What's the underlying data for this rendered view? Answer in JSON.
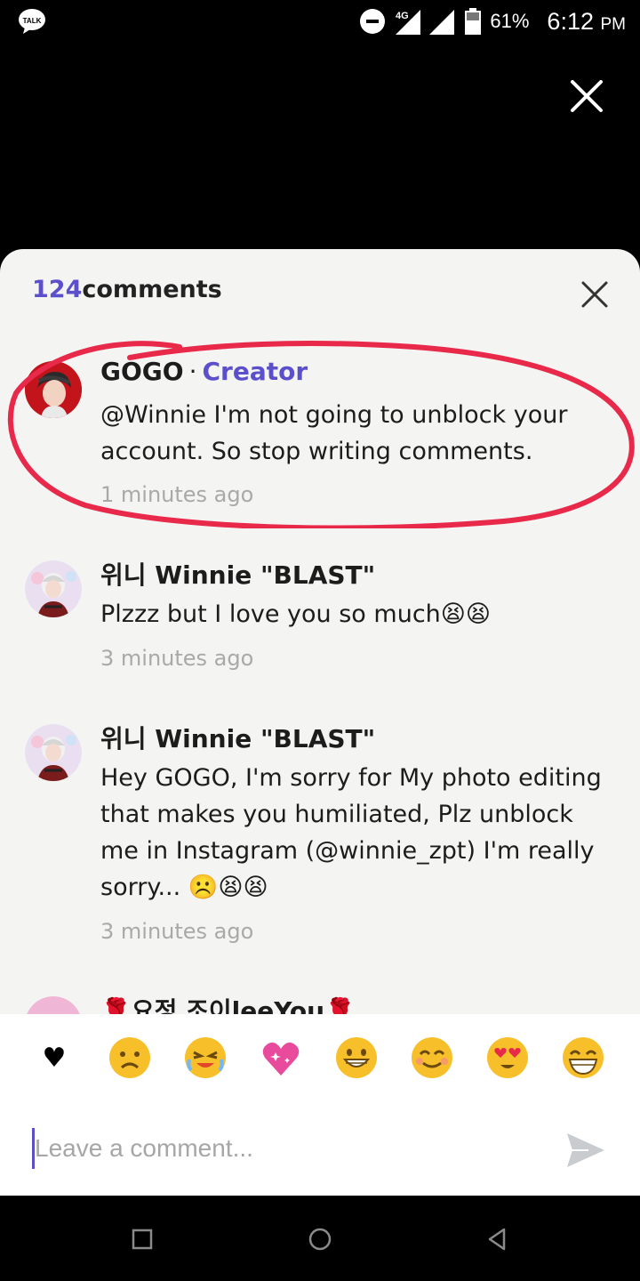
{
  "status_bar": {
    "app_icon_label": "TALK",
    "network": "4G",
    "battery": "61%",
    "time": "6:12",
    "ampm": "PM"
  },
  "sheet": {
    "count": "124",
    "title_suffix": "comments"
  },
  "comments": [
    {
      "name": "GOGO",
      "dot": "·",
      "role": "Creator",
      "text": "@Winnie I'm not going to unblock your account. So stop writing comments.",
      "time": "1 minutes ago"
    },
    {
      "name": "위니 Winnie \"BLAST\"",
      "text": "Plzzz but I love you so much😫😫",
      "time": "3 minutes ago"
    },
    {
      "name": "위니 Winnie \"BLAST\"",
      "text": "Hey GOGO, I'm sorry for My photo editing that makes you humiliated, Plz unblock me in Instagram (@winnie_zpt) I'm really sorry... ☹️😫😫",
      "time": "3 minutes ago"
    },
    {
      "name": "🌹요정 조이leeYou🌹"
    }
  ],
  "emoji_bar": {
    "heart": "♥",
    "emojis": [
      "frown-emoji",
      "crying-emoji",
      "sparkle-heart-emoji",
      "grin-emoji",
      "smile-emoji",
      "heart-eyes-emoji",
      "laughing-emoji"
    ]
  },
  "input": {
    "placeholder": "Leave a comment..."
  },
  "colors": {
    "accent": "#5b4fcc",
    "highlight": "#e8294a",
    "sheet_bg": "#f4f4f3",
    "emoji_yellow": "#f7c02a"
  }
}
